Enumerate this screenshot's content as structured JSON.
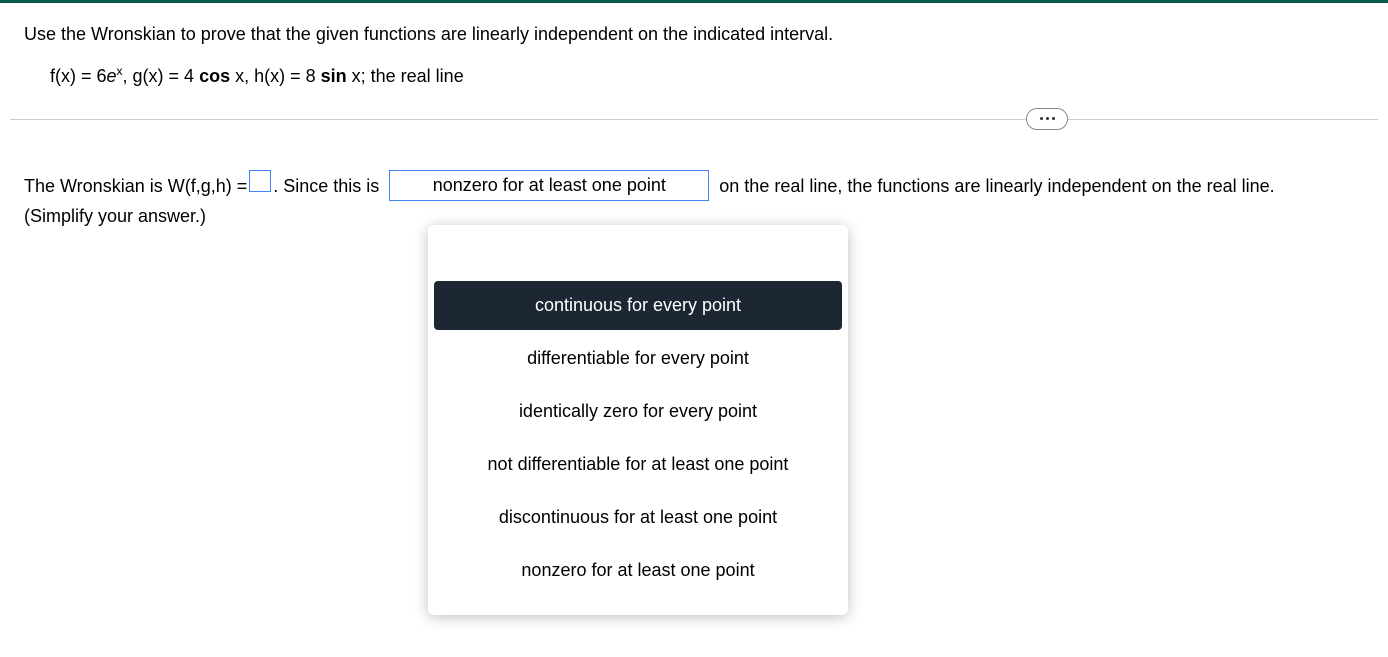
{
  "question": {
    "prompt": "Use the Wronskian to prove that the given functions are linearly independent on the indicated interval.",
    "equation_prefix": "f(x) = 6",
    "equation_e": "e",
    "equation_exp": "x",
    "equation_mid1": ", g(x) = 4 ",
    "equation_cos": "cos",
    "equation_mid2": " x, h(x) = 8 ",
    "equation_sin": "sin",
    "equation_suffix": " x; the real line"
  },
  "answer": {
    "part1": "The Wronskian is W(f,g,h) = ",
    "part2": ". Since this is",
    "part3": "on the real line, the functions are linearly independent on the real line.",
    "simplify": "(Simplify your answer.)"
  },
  "dropdown": {
    "selected_display": "nonzero for at least one point",
    "options": [
      "continuous for every point",
      "differentiable for every point",
      "identically zero for every point",
      "not differentiable for at least one point",
      "discontinuous for at least one point",
      "nonzero for at least one point"
    ],
    "highlighted_index": 0
  }
}
